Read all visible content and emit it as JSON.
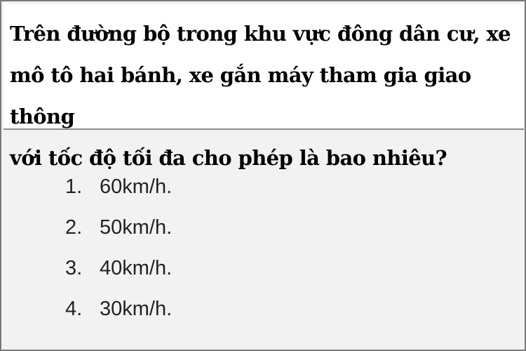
{
  "question": {
    "text": "Trên đường bộ trong khu vực đông dân  cư, xe\nmô tô hai bánh, xe gắn máy tham gia giao thông\nvới tốc độ tối đa cho phép là bao nhiêu?"
  },
  "answers": [
    {
      "number": "1.",
      "label": "60km/h."
    },
    {
      "number": "2.",
      "label": "50km/h."
    },
    {
      "number": "3.",
      "label": "40km/h."
    },
    {
      "number": "4.",
      "label": "30km/h."
    }
  ]
}
